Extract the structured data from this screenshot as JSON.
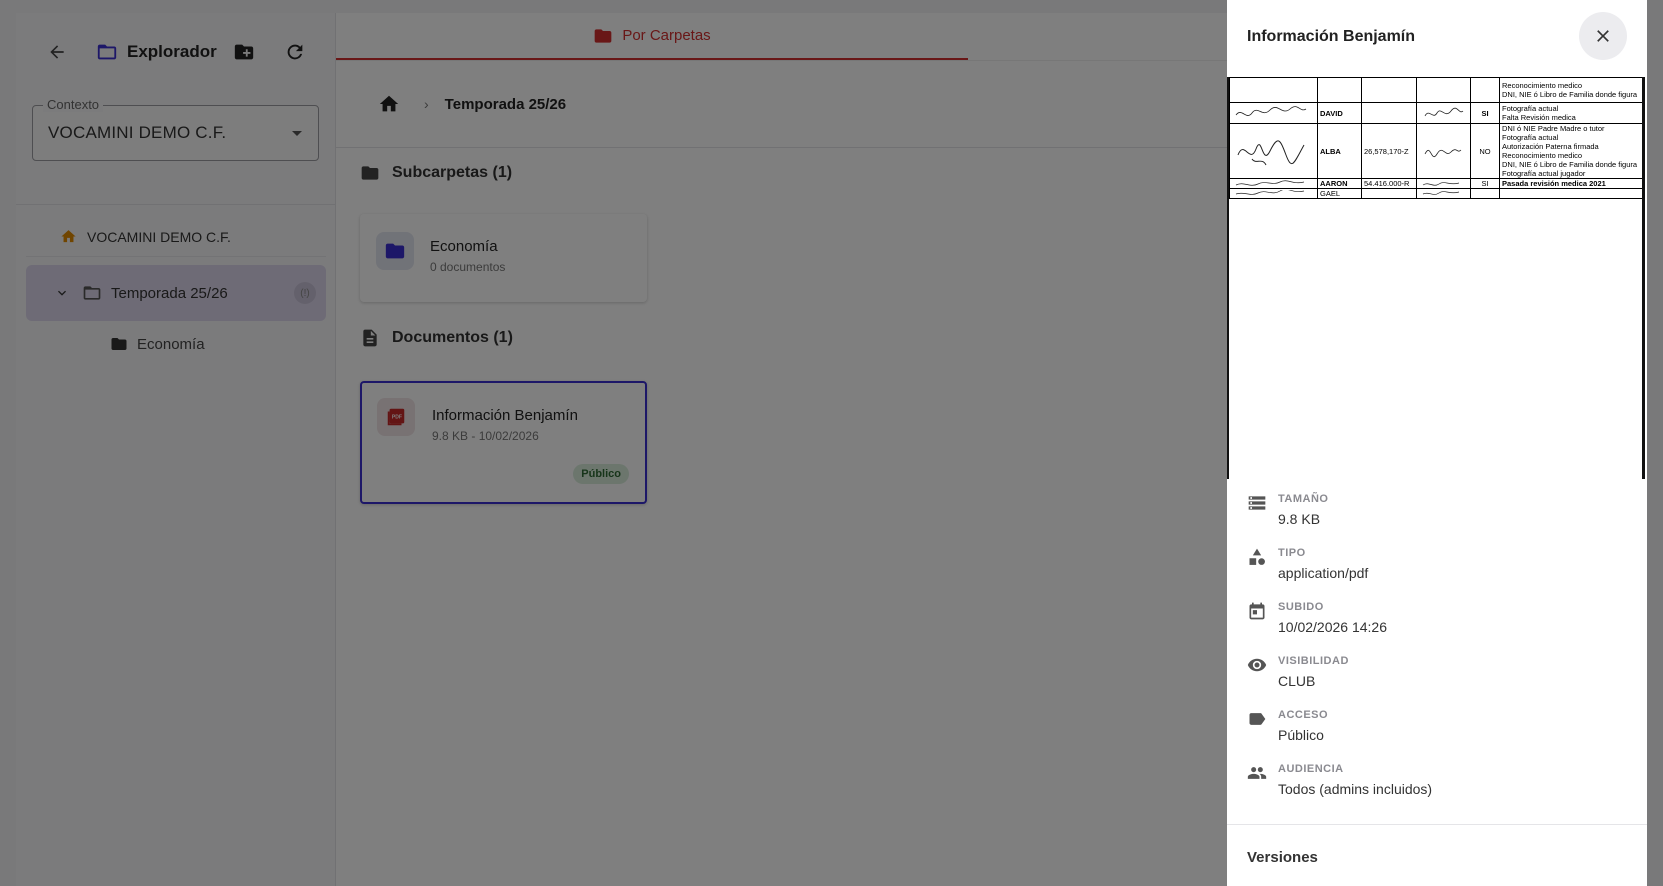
{
  "sidebar": {
    "title": "Explorador",
    "context_label": "Contexto",
    "context_value": "VOCAMINI DEMO C.F.",
    "tree": {
      "root": "VOCAMINI DEMO C.F.",
      "active": "Temporada 25/26",
      "active_badge": "(!)",
      "child": "Economía"
    }
  },
  "main": {
    "tab_label": "Por Carpetas",
    "breadcrumb_current": "Temporada 25/26",
    "subfolders_header": "Subcarpetas (1)",
    "folder_card": {
      "title": "Economía",
      "subtitle": "0 documentos"
    },
    "documents_header": "Documentos (1)",
    "doc_card": {
      "title": "Información Benjamín",
      "subtitle": "9.8 KB - 10/02/2026",
      "badge": "Público",
      "thumb_label": "PDF"
    }
  },
  "drawer": {
    "title": "Información Benjamín",
    "preview": {
      "row0": {
        "notes": [
          "Reconocimiento medico",
          "DNI, NIE ó Libro de Familia donde figura"
        ]
      },
      "row1": {
        "name": "DAVID",
        "id": "",
        "flag": "SI",
        "notes": [
          "Fotografía actual",
          "Falta Revisión medica"
        ]
      },
      "row2": {
        "name": "ALBA",
        "id": "26,578,170-Z",
        "flag": "NO",
        "notes": [
          "DNI ó NIE Padre Madre o tutor",
          "Fotografía actual",
          "Autorización Paterna firmada",
          "Reconocimiento medico",
          "DNI, NIE ó Libro de Familia donde figura",
          "Fotografía actual jugador"
        ]
      },
      "row3": {
        "name": "AARON",
        "id": "54.416.000-R",
        "flag": "SI",
        "note": "Pasada revisión medica 2021"
      },
      "row4": {
        "name": "GAEL"
      }
    },
    "props": {
      "size": {
        "key": "TAMAÑO",
        "value": "9.8 KB"
      },
      "type": {
        "key": "TIPO",
        "value": "application/pdf"
      },
      "uploaded": {
        "key": "SUBIDO",
        "value": "10/02/2026 14:26"
      },
      "visibility": {
        "key": "VISIBILIDAD",
        "value": "CLUB"
      },
      "access": {
        "key": "ACCESO",
        "value": "Público"
      },
      "audience": {
        "key": "AUDIENCIA",
        "value": "Todos (admins incluidos)"
      }
    },
    "versions_title": "Versiones"
  },
  "colors": {
    "accent_red": "#d32f2f",
    "accent_indigo": "#3b2fd1",
    "badge_green_bg": "#d8ecdb",
    "overlay": "rgba(0,0,0,0.5)"
  },
  "icons": [
    "back-arrow-icon",
    "folder-outline-icon",
    "new-folder-icon",
    "refresh-icon",
    "home-icon",
    "chevron-down-icon",
    "folder-icon",
    "file-document-icon",
    "pdf-icon",
    "close-icon",
    "storage-icon",
    "shapes-icon",
    "calendar-icon",
    "eye-icon",
    "tag-icon",
    "people-icon"
  ]
}
